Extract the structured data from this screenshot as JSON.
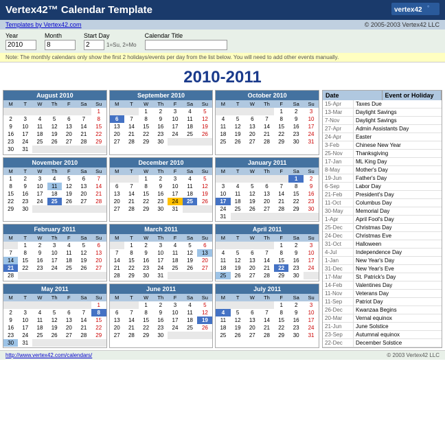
{
  "header": {
    "title": "Vertex42™ Calendar Template",
    "logo": "vertex42°",
    "copyright": "© 2005-2003 Vertex42 LLC",
    "template_link": "Templates by Vertex42.com"
  },
  "controls": {
    "year_label": "Year",
    "year_value": "2010",
    "month_label": "Month",
    "month_value": "8",
    "start_label": "Start Day",
    "start_value": "2",
    "start_hint": "1=Su, 2=Mo",
    "calendar_title_label": "Calendar Title",
    "calendar_title_value": ""
  },
  "note": "Note: The monthly calendars only show the first 2 holidays/events per day from the list below. You will need to add other events manually.",
  "main_title": "2010-2011",
  "months": [
    {
      "title": "August 2010",
      "days_header": [
        "M",
        "T",
        "W",
        "Th",
        "F",
        "Sa",
        "Su"
      ],
      "weeks": [
        [
          "",
          "",
          "",
          "",
          "",
          "",
          "1"
        ],
        [
          "2",
          "3",
          "4",
          "5",
          "6",
          "7",
          "8"
        ],
        [
          "9",
          "10",
          "11",
          "12",
          "13",
          "14",
          "15"
        ],
        [
          "16",
          "17",
          "18",
          "19",
          "20",
          "21",
          "22"
        ],
        [
          "23",
          "24",
          "25",
          "26",
          "27",
          "28",
          "29"
        ],
        [
          "30",
          "31",
          "",
          "",
          "",
          "",
          ""
        ]
      ],
      "highlights": {}
    },
    {
      "title": "September 2010",
      "days_header": [
        "M",
        "T",
        "W",
        "Th",
        "F",
        "Sa",
        "Su"
      ],
      "weeks": [
        [
          "",
          "",
          "1",
          "2",
          "3",
          "4",
          "5"
        ],
        [
          "6",
          "7",
          "8",
          "9",
          "10",
          "11",
          "12"
        ],
        [
          "13",
          "14",
          "15",
          "16",
          "17",
          "18",
          "19"
        ],
        [
          "20",
          "21",
          "22",
          "23",
          "24",
          "25",
          "26"
        ],
        [
          "27",
          "28",
          "29",
          "30",
          "",
          "",
          ""
        ]
      ],
      "highlights": {
        "6": "holiday-blue"
      }
    },
    {
      "title": "October 2010",
      "days_header": [
        "M",
        "T",
        "W",
        "Th",
        "F",
        "Sa",
        "Su"
      ],
      "weeks": [
        [
          "",
          "",
          "",
          "",
          "1",
          "2",
          "3"
        ],
        [
          "4",
          "5",
          "6",
          "7",
          "8",
          "9",
          "10"
        ],
        [
          "18",
          "19",
          "20",
          "21",
          "22",
          "23",
          "24"
        ],
        [
          "25",
          "26",
          "27",
          "28",
          "29",
          "30",
          "31"
        ],
        [
          "",
          "",
          "",
          "",
          "",
          "",
          ""
        ]
      ],
      "highlights": {
        "31": "sunday"
      }
    },
    {
      "title": "November 2010",
      "days_header": [
        "M",
        "T",
        "W",
        "Th",
        "F",
        "Sa",
        "Su"
      ],
      "weeks": [
        [
          "1",
          "2",
          "3",
          "4",
          "5",
          "6",
          "7"
        ],
        [
          "8",
          "9",
          "10",
          "11",
          "12",
          "13",
          "14"
        ],
        [
          "15",
          "16",
          "17",
          "18",
          "19",
          "20",
          "21"
        ],
        [
          "22",
          "23",
          "24",
          "25",
          "26",
          "27",
          "28"
        ],
        [
          "29",
          "30",
          "",
          "",
          "",
          "",
          ""
        ]
      ],
      "highlights": {
        "7": "sunday",
        "11": "holiday-light",
        "14": "sunday",
        "21": "sunday",
        "25": "holiday-blue",
        "28": "sunday"
      }
    },
    {
      "title": "December 2010",
      "days_header": [
        "M",
        "T",
        "W",
        "Th",
        "F",
        "Sa",
        "Su"
      ],
      "weeks": [
        [
          "",
          "",
          "1",
          "2",
          "3",
          "4",
          "5"
        ],
        [
          "6",
          "7",
          "8",
          "9",
          "10",
          "11",
          "12"
        ],
        [
          "13",
          "14",
          "15",
          "16",
          "17",
          "18",
          "19"
        ],
        [
          "20",
          "21",
          "22",
          "23",
          "24",
          "25",
          "26"
        ],
        [
          "27",
          "28",
          "29",
          "30",
          "31",
          "",
          ""
        ]
      ],
      "highlights": {
        "5": "sunday",
        "12": "sunday",
        "19": "sunday",
        "24": "highlight-orange",
        "25": "holiday-blue",
        "26": "sunday"
      }
    },
    {
      "title": "January 2011",
      "days_header": [
        "M",
        "T",
        "W",
        "Th",
        "F",
        "Sa",
        "Su"
      ],
      "weeks": [
        [
          "",
          "",
          "",
          "",
          "",
          "1",
          "2"
        ],
        [
          "3",
          "4",
          "5",
          "6",
          "7",
          "8",
          "9"
        ],
        [
          "10",
          "11",
          "12",
          "13",
          "14",
          "15",
          "16"
        ],
        [
          "17",
          "18",
          "19",
          "20",
          "21",
          "22",
          "23"
        ],
        [
          "24",
          "25",
          "26",
          "27",
          "28",
          "29",
          "30"
        ],
        [
          "31",
          "",
          "",
          "",
          "",
          "",
          ""
        ]
      ],
      "highlights": {
        "1": "today",
        "2": "sunday",
        "9": "sunday",
        "17": "holiday-blue",
        "16": "sunday",
        "23": "sunday",
        "30": "sunday"
      }
    },
    {
      "title": "February 2011",
      "days_header": [
        "M",
        "T",
        "W",
        "Th",
        "F",
        "Sa",
        "Su"
      ],
      "weeks": [
        [
          "",
          "1",
          "2",
          "3",
          "4",
          "5",
          "6"
        ],
        [
          "7",
          "8",
          "9",
          "10",
          "11",
          "12",
          "13"
        ],
        [
          "14",
          "15",
          "16",
          "17",
          "18",
          "19",
          "20"
        ],
        [
          "21",
          "22",
          "23",
          "24",
          "25",
          "26",
          "27"
        ],
        [
          "28",
          "",
          "",
          "",
          "",
          "",
          ""
        ]
      ],
      "highlights": {
        "6": "sunday",
        "13": "sunday",
        "14": "holiday-light",
        "20": "sunday",
        "21": "holiday-blue",
        "27": "sunday"
      }
    },
    {
      "title": "March 2011",
      "days_header": [
        "M",
        "T",
        "W",
        "Th",
        "F",
        "Sa",
        "Su"
      ],
      "weeks": [
        [
          "",
          "1",
          "2",
          "3",
          "4",
          "5",
          "6"
        ],
        [
          "7",
          "8",
          "9",
          "10",
          "11",
          "12",
          "13"
        ],
        [
          "14",
          "15",
          "16",
          "17",
          "18",
          "19",
          "20"
        ],
        [
          "21",
          "22",
          "23",
          "24",
          "25",
          "26",
          "27"
        ],
        [
          "28",
          "29",
          "30",
          "31",
          "",
          "",
          ""
        ]
      ],
      "highlights": {
        "6": "sunday",
        "13": "holiday-light",
        "20": "sunday",
        "27": "sunday"
      }
    },
    {
      "title": "April 2011",
      "days_header": [
        "M",
        "T",
        "W",
        "Th",
        "F",
        "Sa",
        "Su"
      ],
      "weeks": [
        [
          "",
          "",
          "",
          "",
          "1",
          "2",
          "3"
        ],
        [
          "4",
          "5",
          "6",
          "7",
          "8",
          "9",
          "10"
        ],
        [
          "11",
          "12",
          "13",
          "14",
          "15",
          "16",
          "17"
        ],
        [
          "18",
          "19",
          "20",
          "21",
          "22",
          "23",
          "24"
        ],
        [
          "25",
          "26",
          "27",
          "28",
          "29",
          "30",
          ""
        ]
      ],
      "highlights": {
        "3": "sunday",
        "10": "sunday",
        "17": "sunday",
        "22": "holiday-blue",
        "24": "sunday",
        "25": "holiday-light"
      }
    },
    {
      "title": "May 2011",
      "days_header": [
        "M",
        "T",
        "W",
        "Th",
        "F",
        "Sa",
        "Su"
      ],
      "weeks": [
        [
          "",
          "",
          "",
          "",
          "",
          "",
          "1"
        ],
        [
          "2",
          "3",
          "4",
          "5",
          "6",
          "7",
          "8"
        ],
        [
          "9",
          "10",
          "11",
          "12",
          "13",
          "14",
          "15"
        ],
        [
          "16",
          "17",
          "18",
          "19",
          "20",
          "21",
          "22"
        ],
        [
          "23",
          "24",
          "25",
          "26",
          "27",
          "28",
          "29"
        ],
        [
          "30",
          "31",
          "",
          "",
          "",
          "",
          ""
        ]
      ],
      "highlights": {
        "1": "sunday",
        "8": "sunday",
        "15": "sunday",
        "22": "sunday",
        "29": "sunday",
        "30": "holiday-light"
      }
    },
    {
      "title": "June 2011",
      "days_header": [
        "M",
        "T",
        "W",
        "Th",
        "F",
        "Sa",
        "Su"
      ],
      "weeks": [
        [
          "",
          "",
          "1",
          "2",
          "3",
          "4",
          "5"
        ],
        [
          "6",
          "7",
          "8",
          "9",
          "10",
          "11",
          "12"
        ],
        [
          "13",
          "14",
          "15",
          "16",
          "17",
          "18",
          "19"
        ],
        [
          "20",
          "21",
          "22",
          "23",
          "24",
          "25",
          "26"
        ],
        [
          "27",
          "28",
          "29",
          "30",
          "",
          "",
          ""
        ]
      ],
      "highlights": {
        "5": "sunday",
        "12": "sunday",
        "19": "sunday",
        "26": "sunday"
      }
    },
    {
      "title": "July 2011",
      "days_header": [
        "M",
        "T",
        "W",
        "Th",
        "F",
        "Sa",
        "Su"
      ],
      "weeks": [
        [
          "",
          "",
          "",
          "",
          "1",
          "2",
          "3"
        ],
        [
          "4",
          "5",
          "6",
          "7",
          "8",
          "9",
          "10"
        ],
        [
          "11",
          "12",
          "13",
          "14",
          "15",
          "16",
          "17"
        ],
        [
          "18",
          "19",
          "20",
          "21",
          "22",
          "23",
          "24"
        ],
        [
          "25",
          "26",
          "27",
          "28",
          "29",
          "30",
          "31"
        ]
      ],
      "highlights": {
        "3": "sunday",
        "4": "holiday-blue",
        "10": "sunday",
        "17": "sunday",
        "24": "sunday",
        "31": "sunday"
      }
    }
  ],
  "sidebar": {
    "col1": "Date",
    "col2": "Event or Holiday",
    "holidays": [
      {
        "date": "15-Apr",
        "name": "Taxes Due"
      },
      {
        "date": "13-Mar",
        "name": "Daylight Savings"
      },
      {
        "date": "7-Nov",
        "name": "Daylight Savings"
      },
      {
        "date": "27-Apr",
        "name": "Admin Assistants Day"
      },
      {
        "date": "24-Apr",
        "name": "Easter"
      },
      {
        "date": "3-Feb",
        "name": "Chinese New Year"
      },
      {
        "date": "25-Nov",
        "name": "Thanksgiving"
      },
      {
        "date": "17-Jan",
        "name": "ML King Day"
      },
      {
        "date": "8-May",
        "name": "Mother's Day"
      },
      {
        "date": "19-Jun",
        "name": "Father's Day"
      },
      {
        "date": "6-Sep",
        "name": "Labor Day"
      },
      {
        "date": "21-Feb",
        "name": "President's Day"
      },
      {
        "date": "11-Oct",
        "name": "Columbus Day"
      },
      {
        "date": "30-May",
        "name": "Memorial Day"
      },
      {
        "date": "1-Apr",
        "name": "April Fool's Day"
      },
      {
        "date": "25-Dec",
        "name": "Christmas Day"
      },
      {
        "date": "24-Dec",
        "name": "Christmas Eve"
      },
      {
        "date": "31-Oct",
        "name": "Halloween"
      },
      {
        "date": "4-Jul",
        "name": "Independence Day"
      },
      {
        "date": "1-Jan",
        "name": "New Year's Day"
      },
      {
        "date": "31-Dec",
        "name": "New Year's Eve"
      },
      {
        "date": "17-Mar",
        "name": "St. Patrick's Day"
      },
      {
        "date": "14-Feb",
        "name": "Valentines Day"
      },
      {
        "date": "11-Nov",
        "name": "Veterans Day"
      },
      {
        "date": "11-Sep",
        "name": "Patriot Day"
      },
      {
        "date": "26-Dec",
        "name": "Kwanzaa Begins"
      },
      {
        "date": "20-Mar",
        "name": "Vernal equinox"
      },
      {
        "date": "21-Jun",
        "name": "June Solstice"
      },
      {
        "date": "23-Sep",
        "name": "Autumnal equinox"
      },
      {
        "date": "22-Dec",
        "name": "December Solstice"
      }
    ]
  },
  "footer": {
    "link_text": "http://www.vertex42.com/calendars/",
    "copyright": "© 2003 Vertex42 LLC"
  }
}
